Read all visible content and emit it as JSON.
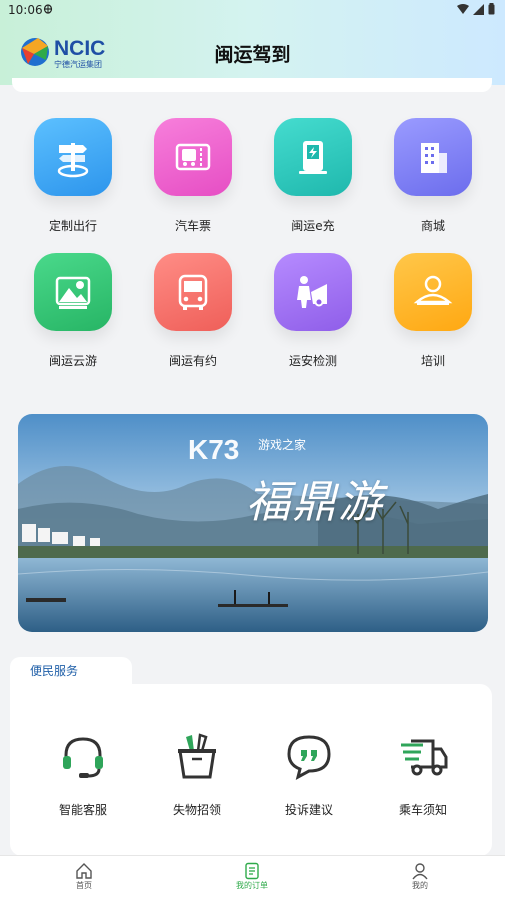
{
  "status_bar": {
    "time": "10:06",
    "extra_icon": "bug-icon",
    "icons": [
      "wifi-icon",
      "signal-icon",
      "battery-icon"
    ]
  },
  "header": {
    "title": "闽运驾到",
    "logo_text": "NCIC",
    "logo_sub": "宁德汽运集团"
  },
  "grid": {
    "items": [
      {
        "label": "定制出行",
        "icon": "signpost-icon",
        "color": "#3aa8f0"
      },
      {
        "label": "汽车票",
        "icon": "bus-ticket-icon",
        "color": "#ee5ecb"
      },
      {
        "label": "闽运e充",
        "icon": "charging-station-icon",
        "color": "#2ec8bf"
      },
      {
        "label": "商城",
        "icon": "building-icon",
        "color": "#7f7ff2"
      },
      {
        "label": "闽运云游",
        "icon": "landscape-icon",
        "color": "#36c779"
      },
      {
        "label": "闽运有约",
        "icon": "bus-icon",
        "color": "#f5746d"
      },
      {
        "label": "运安检测",
        "icon": "car-inspection-icon",
        "color": "#a472f0"
      },
      {
        "label": "培训",
        "icon": "driver-icon",
        "color": "#ffb827"
      }
    ]
  },
  "banner": {
    "watermark": "K73",
    "watermark_sub": "游戏之家",
    "calligraphy": "福鼎游"
  },
  "services": {
    "title": "便民服务",
    "items": [
      {
        "label": "智能客服",
        "icon": "headset-icon"
      },
      {
        "label": "失物招领",
        "icon": "lost-found-icon"
      },
      {
        "label": "投诉建议",
        "icon": "feedback-icon"
      },
      {
        "label": "乘车须知",
        "icon": "truck-notice-icon"
      }
    ]
  },
  "tabbar": {
    "items": [
      {
        "label": "首页",
        "icon": "home-icon"
      },
      {
        "label": "我的订单",
        "icon": "orders-icon",
        "active": true
      },
      {
        "label": "我的",
        "icon": "profile-icon"
      }
    ]
  },
  "colors": {
    "accent_green": "#2faa4a",
    "service_green": "#2fa55a",
    "brand_blue": "#1f4fa5"
  }
}
